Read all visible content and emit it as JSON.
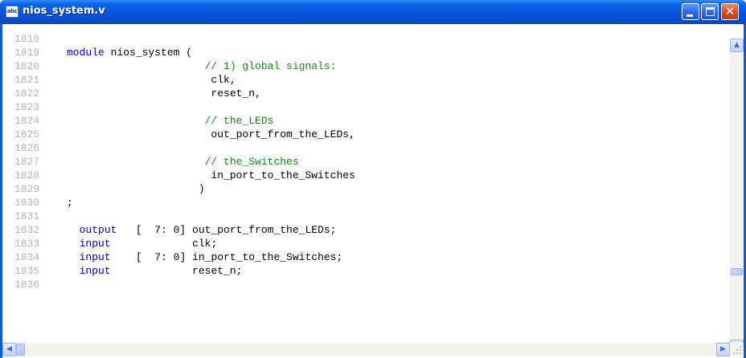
{
  "window": {
    "title": "nios_system.v",
    "icon_label": "abc",
    "icon": "text-file-icon",
    "controls": {
      "minimize": "minimize-icon",
      "maximize": "maximize-icon",
      "close": "✕"
    }
  },
  "editor": {
    "lines": [
      {
        "n": "1818",
        "text": ""
      },
      {
        "n": "1819",
        "text": "module nios_system ("
      },
      {
        "n": "1820",
        "text": "                      // 1) global signals:"
      },
      {
        "n": "1821",
        "text": "                       clk,"
      },
      {
        "n": "1822",
        "text": "                       reset_n,"
      },
      {
        "n": "1823",
        "text": ""
      },
      {
        "n": "1824",
        "text": "                      // the_LEDs"
      },
      {
        "n": "1825",
        "text": "                       out_port_from_the_LEDs,"
      },
      {
        "n": "1826",
        "text": ""
      },
      {
        "n": "1827",
        "text": "                      // the_Switches"
      },
      {
        "n": "1828",
        "text": "                       in_port_to_the_Switches"
      },
      {
        "n": "1829",
        "text": "                     )"
      },
      {
        "n": "1830",
        "text": ";"
      },
      {
        "n": "1831",
        "text": ""
      },
      {
        "n": "1832",
        "text": "  output   [  7: 0] out_port_from_the_LEDs;"
      },
      {
        "n": "1833",
        "text": "  input             clk;"
      },
      {
        "n": "1834",
        "text": "  input    [  7: 0] in_port_to_the_Switches;"
      },
      {
        "n": "1835",
        "text": "  input             reset_n;"
      },
      {
        "n": "1836",
        "text": ""
      }
    ]
  },
  "scrollbars": {
    "vertical_up": "▲",
    "vertical_down": "▼",
    "horizontal_left": "◀",
    "horizontal_right": "▶",
    "vertical_position": 0.77
  },
  "colors": {
    "titlebar": "#0a5bd8",
    "keyword": "#0000b8",
    "comment": "#0d8a0d",
    "line_number": "#b4b4b4"
  }
}
